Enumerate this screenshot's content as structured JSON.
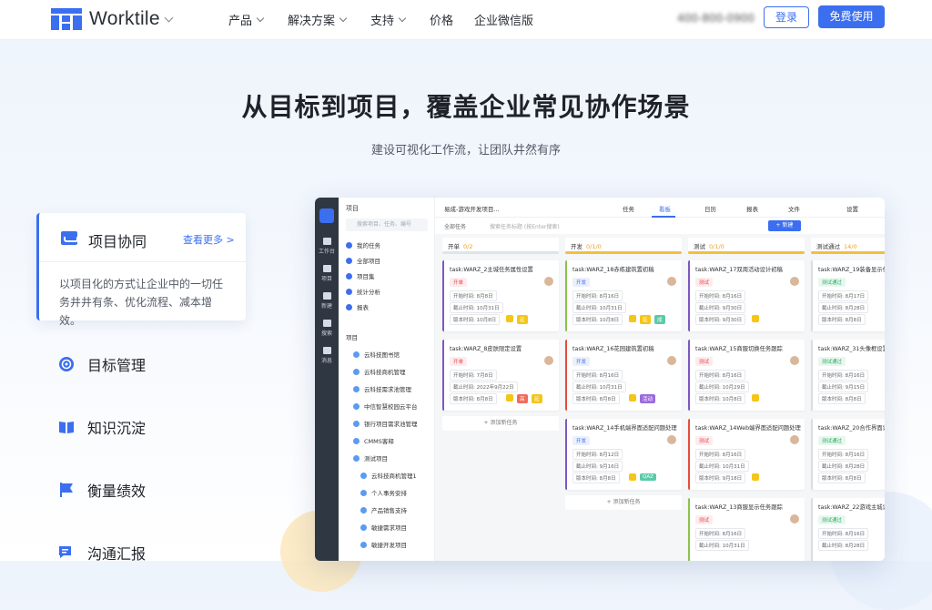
{
  "nav": {
    "logo_text": "Worktile",
    "items": [
      {
        "label": "产品",
        "has_caret": true
      },
      {
        "label": "解决方案",
        "has_caret": true
      },
      {
        "label": "支持",
        "has_caret": true
      },
      {
        "label": "价格",
        "has_caret": false
      },
      {
        "label": "企业微信版",
        "has_caret": false
      }
    ],
    "phone": "400-800-0900",
    "login": "登录",
    "free_use": "免费使用",
    "accent": "#3b6ff0"
  },
  "hero": {
    "title": "从目标到项目，覆盖企业常见协作场景",
    "subtitle": "建设可视化工作流，让团队井然有序"
  },
  "features": {
    "active": {
      "title": "项目协同",
      "more": "查看更多 >",
      "desc": "以项目化的方式让企业中的一切任务井井有条、优化流程、减本增效。"
    },
    "items": [
      {
        "label": "目标管理",
        "icon": "target-icon"
      },
      {
        "label": "知识沉淀",
        "icon": "book-icon"
      },
      {
        "label": "衡量绩效",
        "icon": "flag-icon"
      },
      {
        "label": "沟通汇报",
        "icon": "chat-icon"
      }
    ]
  },
  "app": {
    "rail": [
      "工作台",
      "项目",
      "新建",
      "搜索",
      "消息"
    ],
    "sidebar": {
      "header": "项目",
      "search_placeholder": "搜索项目、任务、编号",
      "items": [
        "我的任务",
        "全部项目",
        "项目集",
        "统计分析",
        "报表"
      ],
      "section": "项目",
      "projects": [
        "云科技图书馆",
        "云科技商机管理",
        "云科技需求池管理",
        "中信智慧校园云平台",
        "银行项目需求池管理",
        "CMMS客释",
        "测试项目",
        "云科技商机管理1",
        "个人事务安排",
        "产品销售支持",
        "敏捷需求项目",
        "敏捷开发项目"
      ]
    },
    "topbar": {
      "project": "易成-游戏开发项目...",
      "tabs": [
        "任务",
        "看板",
        "日历",
        "报表",
        "文件"
      ],
      "active_tab": "看板",
      "settings": "设置"
    },
    "filter": {
      "all": "全部任务",
      "search": "搜索任务标题 (按Enter搜索)",
      "new": "+ 新建"
    },
    "columns": [
      {
        "name": "开单",
        "count": "0/2",
        "bar": "#dfe3ea",
        "tasks": [
          {
            "title": "task:WARZ_2主城任务属性设置",
            "status": "开单",
            "status_color": "#e8474e",
            "start": "开始时间: 8月8日",
            "end": "截止时间: 10月31日",
            "extra": "版本时间: 10月8日",
            "tags": [
              {
                "t": "",
                "c": "#f5c518"
              },
              {
                "t": "延",
                "c": "#f5c518"
              }
            ],
            "border": "#7e57c2"
          },
          {
            "title": "task:WARZ_8皮肤限定设置",
            "status": "开单",
            "status_color": "#e8474e",
            "start": "开始时间: 7月8日",
            "end": "截止时间: 2022年9月22日",
            "extra": "版本时间: 8月8日",
            "tags": [
              {
                "t": "",
                "c": "#f5c518"
              },
              {
                "t": "高",
                "c": "#f06c5a"
              },
              {
                "t": "延",
                "c": "#f5c518"
              }
            ],
            "border": "#7e57c2"
          }
        ],
        "add": "+ 添加新任务"
      },
      {
        "name": "开发",
        "count": "0/1/0",
        "bar": "#f0c040",
        "tasks": [
          {
            "title": "task:WARZ_18赤练建筑置初稿",
            "status": "开发",
            "status_color": "#3b6ff0",
            "start": "开始时间: 8月16日",
            "end": "截止时间: 10月31日",
            "extra": "版本时间: 10月8日",
            "tags": [
              {
                "t": "",
                "c": "#f5c518"
              },
              {
                "t": "延",
                "c": "#f5c518"
              },
              {
                "t": "成",
                "c": "#5cc9a7"
              }
            ],
            "border": "#8bc34a"
          },
          {
            "title": "task:WARZ_16花园建筑置初稿",
            "status": "开发",
            "status_color": "#3b6ff0",
            "start": "开始时间: 8月16日",
            "end": "截止时间: 10月31日",
            "extra": "版本时间: 8月8日",
            "tags": [
              {
                "t": "",
                "c": "#f5c518"
              },
              {
                "t": "活动",
                "c": "#9c6ade"
              }
            ],
            "border": "#e74c3c"
          },
          {
            "title": "task:WARZ_14手机端界面适配问题处理",
            "status": "开发",
            "status_color": "#3b6ff0",
            "start": "开始时间: 8月12日",
            "end": "截止时间: 9月16日",
            "extra": "版本时间: 8月8日",
            "tags": [
              {
                "t": "",
                "c": "#f5c518"
              },
              {
                "t": "QAZ",
                "c": "#5cc9a7"
              }
            ],
            "border": "#7e57c2"
          }
        ],
        "add": "+ 添加新任务"
      },
      {
        "name": "测试",
        "count": "0/1/0",
        "bar": "#f0c040",
        "tasks": [
          {
            "title": "task:WARZ_17双周活动设计初稿",
            "status": "测试",
            "status_color": "#e8474e",
            "start": "开始时间: 8月16日",
            "end": "截止时间: 9月30日",
            "extra": "版本时间: 9月30日",
            "tags": [
              {
                "t": "",
                "c": "#f5c518"
              }
            ],
            "border": "#7e57c2"
          },
          {
            "title": "task:WARZ_15商服切换任务跟踪",
            "status": "测试",
            "status_color": "#e8474e",
            "start": "开始时间: 8月16日",
            "end": "截止时间: 10月29日",
            "extra": "版本时间: 10月8日",
            "tags": [
              {
                "t": "",
                "c": "#f5c518"
              }
            ],
            "border": "#7e57c2"
          },
          {
            "title": "task:WARZ_14Web端界面适配问题处理",
            "status": "测试",
            "status_color": "#e8474e",
            "start": "开始时间: 8月16日",
            "end": "截止时间: 10月31日",
            "extra": "版本时间: 9月18日",
            "tags": [
              {
                "t": "",
                "c": "#f5c518"
              }
            ],
            "border": "#e74c3c"
          },
          {
            "title": "task:WARZ_13商服显示任务跟踪",
            "status": "测试",
            "status_color": "#e8474e",
            "start": "开始时间: 8月16日",
            "end": "截止时间: 10月31日",
            "extra": "",
            "tags": [],
            "border": "#8bc34a"
          }
        ],
        "add": ""
      },
      {
        "name": "测试通过",
        "count": "14/0",
        "bar": "#f0c040",
        "tasks": [
          {
            "title": "task:WARZ_19装备显示任务",
            "status": "测试通过",
            "status_color": "#27ae60",
            "start": "开始时间: 8月17日",
            "end": "截止时间: 8月28日",
            "extra": "版本时间: 8月8日",
            "tags": [],
            "border": "#ddd"
          },
          {
            "title": "task:WARZ_31头像框设置",
            "status": "测试通过",
            "status_color": "#27ae60",
            "start": "开始时间: 8月16日",
            "end": "截止时间: 9月15日",
            "extra": "版本时间: 8月8日",
            "tags": [],
            "border": "#ddd"
          },
          {
            "title": "task:WARZ_20合作界面设计",
            "status": "测试通过",
            "status_color": "#27ae60",
            "start": "开始时间: 8月16日",
            "end": "截止时间: 8月28日",
            "extra": "版本时间: 8月8日",
            "tags": [],
            "border": "#ddd"
          },
          {
            "title": "task:WARZ_22游戏主城设计",
            "status": "测试通过",
            "status_color": "#27ae60",
            "start": "开始时间: 8月16日",
            "end": "截止时间: 8月28日",
            "extra": "",
            "tags": [],
            "border": "#ddd"
          }
        ],
        "add": ""
      }
    ]
  }
}
